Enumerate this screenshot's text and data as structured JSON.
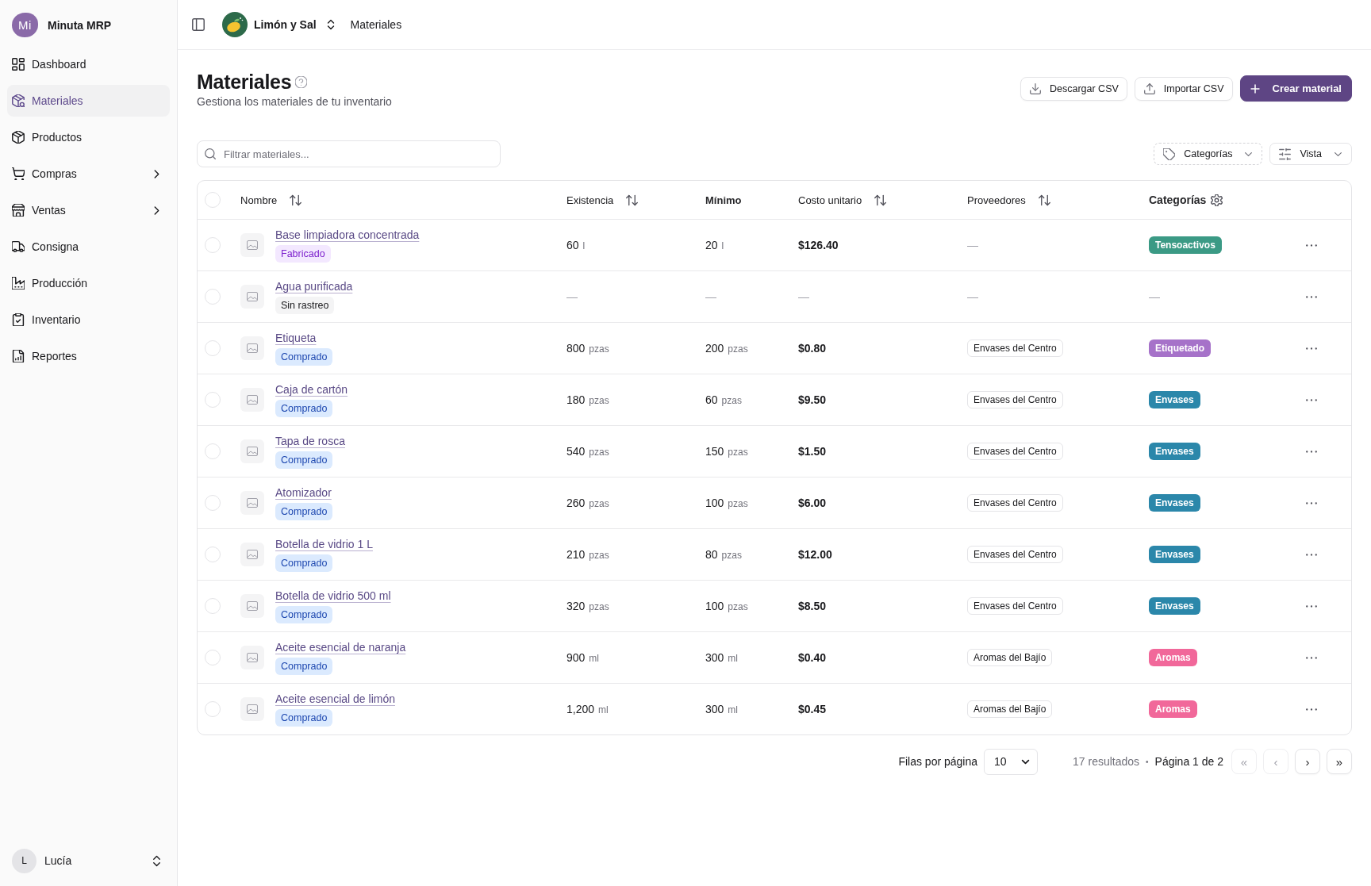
{
  "sidebar": {
    "brand": {
      "logo_text": "Mi",
      "name": "Minuta MRP"
    },
    "items": [
      {
        "label": "Dashboard",
        "kind": "dashboard",
        "selected": false,
        "submenu": false
      },
      {
        "label": "Materiales",
        "kind": "materials",
        "selected": true,
        "submenu": false
      },
      {
        "label": "Productos",
        "kind": "products",
        "selected": false,
        "submenu": false
      },
      {
        "label": "Compras",
        "kind": "purchases",
        "selected": false,
        "submenu": true
      },
      {
        "label": "Ventas",
        "kind": "sales",
        "selected": false,
        "submenu": true
      },
      {
        "label": "Consigna",
        "kind": "consignment",
        "selected": false,
        "submenu": false
      },
      {
        "label": "Producción",
        "kind": "production",
        "selected": false,
        "submenu": false
      },
      {
        "label": "Inventario",
        "kind": "inventory",
        "selected": false,
        "submenu": false
      },
      {
        "label": "Reportes",
        "kind": "reports",
        "selected": false,
        "submenu": false
      }
    ],
    "user": {
      "initial": "L",
      "name": "Lucía"
    }
  },
  "header": {
    "organization": "Limón y Sal",
    "breadcrumb": "Materiales"
  },
  "page": {
    "title": "Materiales",
    "subtitle": "Gestiona los materiales de tu inventario",
    "actions": [
      {
        "label": "Descargar CSV",
        "kind": "download"
      },
      {
        "label": "Importar CSV",
        "kind": "upload"
      },
      {
        "label": "Crear material",
        "kind": "create"
      }
    ]
  },
  "toolbar": {
    "search": {
      "placeholder": "Filtrar materiales..."
    },
    "filters": [
      {
        "label": "Categorías",
        "kind": "tags"
      },
      {
        "label": "Vista",
        "kind": "view"
      }
    ]
  },
  "table": {
    "select_all": {
      "checked": false
    },
    "columns": [
      {
        "label": "Nombre",
        "kind": "sortable"
      },
      {
        "label": "Existencia",
        "kind": "sortable"
      },
      {
        "label": "Mínimo",
        "kind": "plain"
      },
      {
        "label": "Costo unitario",
        "kind": "sortable"
      },
      {
        "label": "Proveedores",
        "kind": "sortable"
      },
      {
        "label": "Categorías",
        "kind": "settings"
      }
    ],
    "rows": [
      {
        "checked": false,
        "name": "Base limpiadora concentrada",
        "type": {
          "label": "Fabricado",
          "kind": "manufactured"
        },
        "stock": {
          "kind": "quantity",
          "value": "60",
          "unit": "l"
        },
        "minimum": {
          "kind": "quantity",
          "value": "20",
          "unit": "l"
        },
        "unit_cost": {
          "kind": "amount",
          "value": "$126.40"
        },
        "supplier": {
          "kind": "empty",
          "value": "—"
        },
        "category": {
          "kind": "tag",
          "value": "Tensoactivos",
          "color": "#3b9a85"
        }
      },
      {
        "checked": false,
        "name": "Agua purificada",
        "type": {
          "label": "Sin rastreo",
          "kind": "untracked"
        },
        "stock": {
          "kind": "empty",
          "value": "—"
        },
        "minimum": {
          "kind": "empty",
          "value": "—"
        },
        "unit_cost": {
          "kind": "empty",
          "value": "—"
        },
        "supplier": {
          "kind": "empty",
          "value": "—"
        },
        "category": {
          "kind": "empty",
          "value": "—"
        }
      },
      {
        "checked": false,
        "name": "Etiqueta",
        "type": {
          "label": "Comprado",
          "kind": "purchased"
        },
        "stock": {
          "kind": "quantity",
          "value": "800",
          "unit": "pzas"
        },
        "minimum": {
          "kind": "quantity",
          "value": "200",
          "unit": "pzas"
        },
        "unit_cost": {
          "kind": "amount",
          "value": "$0.80"
        },
        "supplier": {
          "kind": "chip",
          "value": "Envases del Centro"
        },
        "category": {
          "kind": "tag",
          "value": "Etiquetado",
          "color": "#a672c9"
        }
      },
      {
        "checked": false,
        "name": "Caja de cartón",
        "type": {
          "label": "Comprado",
          "kind": "purchased"
        },
        "stock": {
          "kind": "quantity",
          "value": "180",
          "unit": "pzas"
        },
        "minimum": {
          "kind": "quantity",
          "value": "60",
          "unit": "pzas"
        },
        "unit_cost": {
          "kind": "amount",
          "value": "$9.50"
        },
        "supplier": {
          "kind": "chip",
          "value": "Envases del Centro"
        },
        "category": {
          "kind": "tag",
          "value": "Envases",
          "color": "#2b87aa"
        }
      },
      {
        "checked": false,
        "name": "Tapa de rosca",
        "type": {
          "label": "Comprado",
          "kind": "purchased"
        },
        "stock": {
          "kind": "quantity",
          "value": "540",
          "unit": "pzas"
        },
        "minimum": {
          "kind": "quantity",
          "value": "150",
          "unit": "pzas"
        },
        "unit_cost": {
          "kind": "amount",
          "value": "$1.50"
        },
        "supplier": {
          "kind": "chip",
          "value": "Envases del Centro"
        },
        "category": {
          "kind": "tag",
          "value": "Envases",
          "color": "#2b87aa"
        }
      },
      {
        "checked": false,
        "name": "Atomizador",
        "type": {
          "label": "Comprado",
          "kind": "purchased"
        },
        "stock": {
          "kind": "quantity",
          "value": "260",
          "unit": "pzas"
        },
        "minimum": {
          "kind": "quantity",
          "value": "100",
          "unit": "pzas"
        },
        "unit_cost": {
          "kind": "amount",
          "value": "$6.00"
        },
        "supplier": {
          "kind": "chip",
          "value": "Envases del Centro"
        },
        "category": {
          "kind": "tag",
          "value": "Envases",
          "color": "#2b87aa"
        }
      },
      {
        "checked": false,
        "name": "Botella de vidrio 1 L",
        "type": {
          "label": "Comprado",
          "kind": "purchased"
        },
        "stock": {
          "kind": "quantity",
          "value": "210",
          "unit": "pzas"
        },
        "minimum": {
          "kind": "quantity",
          "value": "80",
          "unit": "pzas"
        },
        "unit_cost": {
          "kind": "amount",
          "value": "$12.00"
        },
        "supplier": {
          "kind": "chip",
          "value": "Envases del Centro"
        },
        "category": {
          "kind": "tag",
          "value": "Envases",
          "color": "#2b87aa"
        }
      },
      {
        "checked": false,
        "name": "Botella de vidrio 500 ml",
        "type": {
          "label": "Comprado",
          "kind": "purchased"
        },
        "stock": {
          "kind": "quantity",
          "value": "320",
          "unit": "pzas"
        },
        "minimum": {
          "kind": "quantity",
          "value": "100",
          "unit": "pzas"
        },
        "unit_cost": {
          "kind": "amount",
          "value": "$8.50"
        },
        "supplier": {
          "kind": "chip",
          "value": "Envases del Centro"
        },
        "category": {
          "kind": "tag",
          "value": "Envases",
          "color": "#2b87aa"
        }
      },
      {
        "checked": false,
        "name": "Aceite esencial de naranja",
        "type": {
          "label": "Comprado",
          "kind": "purchased"
        },
        "stock": {
          "kind": "quantity",
          "value": "900",
          "unit": "ml"
        },
        "minimum": {
          "kind": "quantity",
          "value": "300",
          "unit": "ml"
        },
        "unit_cost": {
          "kind": "amount",
          "value": "$0.40"
        },
        "supplier": {
          "kind": "chip",
          "value": "Aromas del Bajío"
        },
        "category": {
          "kind": "tag",
          "value": "Aromas",
          "color": "#f1689a"
        }
      },
      {
        "checked": false,
        "name": "Aceite esencial de limón",
        "type": {
          "label": "Comprado",
          "kind": "purchased"
        },
        "stock": {
          "kind": "quantity",
          "value": "1,200",
          "unit": "ml"
        },
        "minimum": {
          "kind": "quantity",
          "value": "300",
          "unit": "ml"
        },
        "unit_cost": {
          "kind": "amount",
          "value": "$0.45"
        },
        "supplier": {
          "kind": "chip",
          "value": "Aromas del Bajío"
        },
        "category": {
          "kind": "tag",
          "value": "Aromas",
          "color": "#f1689a"
        }
      }
    ]
  },
  "pagination": {
    "rows_per_page_label": "Filas por página",
    "rows_per_page": "10",
    "results": "17 resultados",
    "separator": "•",
    "page": "Página 1 de 2",
    "buttons": [
      {
        "label": "«",
        "disabled": true
      },
      {
        "label": "‹",
        "disabled": true
      },
      {
        "label": "›",
        "disabled": false
      },
      {
        "label": "»",
        "disabled": false
      }
    ]
  }
}
